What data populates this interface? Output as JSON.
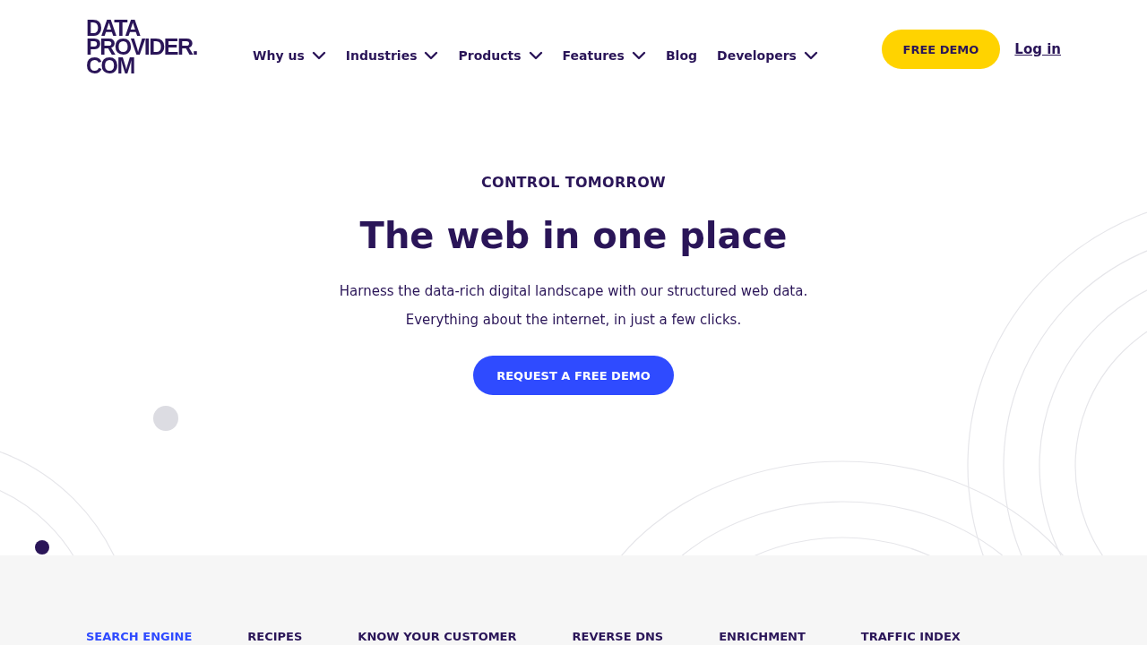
{
  "logo": {
    "lines": [
      "DATA",
      "PROVIDER.",
      "COM"
    ]
  },
  "nav": [
    {
      "label": "Why us",
      "has_dropdown": true
    },
    {
      "label": "Industries",
      "has_dropdown": true
    },
    {
      "label": "Products",
      "has_dropdown": true
    },
    {
      "label": "Features",
      "has_dropdown": true
    },
    {
      "label": "Blog",
      "has_dropdown": false
    },
    {
      "label": "Developers",
      "has_dropdown": true
    }
  ],
  "header_actions": {
    "demo_button": "FREE DEMO",
    "login_link": "Log in"
  },
  "hero": {
    "eyebrow": "CONTROL TOMORROW",
    "title": "The web in one place",
    "lines": [
      "Harness the data-rich digital landscape with our structured web data.",
      "Everything about the internet, in just a few clicks."
    ],
    "button": "REQUEST A FREE DEMO"
  },
  "use_case_tabs": [
    {
      "label": "SEARCH ENGINE",
      "selected": true
    },
    {
      "label": "RECIPES",
      "selected": false
    },
    {
      "label": "KNOW YOUR CUSTOMER",
      "selected": false
    },
    {
      "label": "REVERSE DNS",
      "selected": false
    },
    {
      "label": "ENRICHMENT",
      "selected": false
    },
    {
      "label": "TRAFFIC INDEX",
      "selected": false
    }
  ]
}
